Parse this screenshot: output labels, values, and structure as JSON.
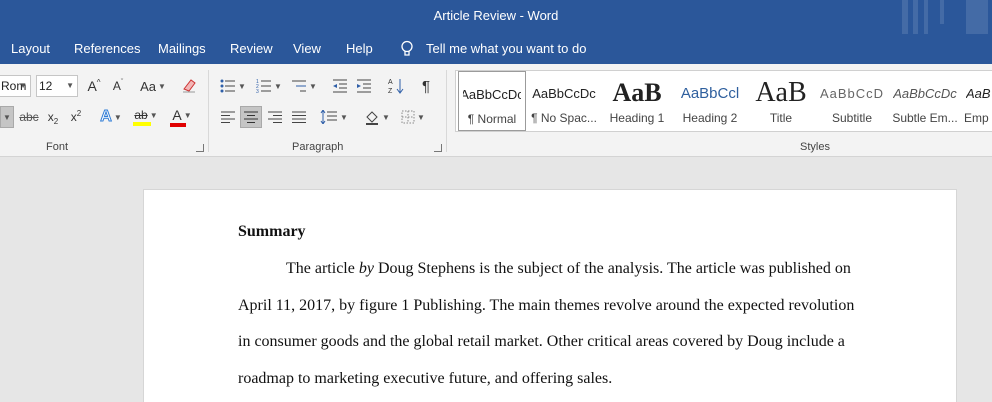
{
  "window": {
    "title": "Article Review  -  Word"
  },
  "menu": {
    "tabs": [
      "Layout",
      "References",
      "Mailings",
      "Review",
      "View",
      "Help"
    ],
    "tell_me": "Tell me what you want to do"
  },
  "ribbon": {
    "font_group": {
      "label": "Font",
      "font_name": "Rom",
      "font_size": "12",
      "grow": "A",
      "shrink": "A",
      "change_case": "Aa",
      "strikethrough": "abc",
      "subscript": "x",
      "subscript_mark": "2",
      "superscript": "x",
      "superscript_mark": "2",
      "text_effects": "A",
      "highlight": "ab",
      "font_color": "A"
    },
    "paragraph_group": {
      "label": "Paragraph",
      "pilcrow": "¶"
    },
    "styles_group": {
      "label": "Styles",
      "items": [
        {
          "preview": "AaBbCcDc",
          "name": "¶ Normal"
        },
        {
          "preview": "AaBbCcDc",
          "name": "¶ No Spac..."
        },
        {
          "preview": "AaB",
          "name": "Heading 1"
        },
        {
          "preview": "AaBbCcl",
          "name": "Heading 2"
        },
        {
          "preview": "AaB",
          "name": "Title"
        },
        {
          "preview": "AaBbCcD",
          "name": "Subtitle"
        },
        {
          "preview": "AaBbCcDc",
          "name": "Subtle Em..."
        },
        {
          "preview": "AaB",
          "name": "Emp"
        }
      ]
    }
  },
  "document": {
    "heading": "Summary",
    "para_line1_a": "The article ",
    "para_line1_italic": "by",
    "para_line1_b": " Doug Stephens is the subject of the analysis. The article was published on",
    "para_line2": "April 11, 2017, by figure 1 Publishing. The main themes revolve around the expected revolution",
    "para_line3": "in consumer goods and the global retail market. Other critical areas covered by Doug include a",
    "para_line4": "roadmap to marketing executive future, and offering sales."
  },
  "colors": {
    "brand": "#2b579a",
    "highlight_yellow": "#ffff00",
    "font_red": "#e00000",
    "effects_blue": "#2f7cd6"
  }
}
